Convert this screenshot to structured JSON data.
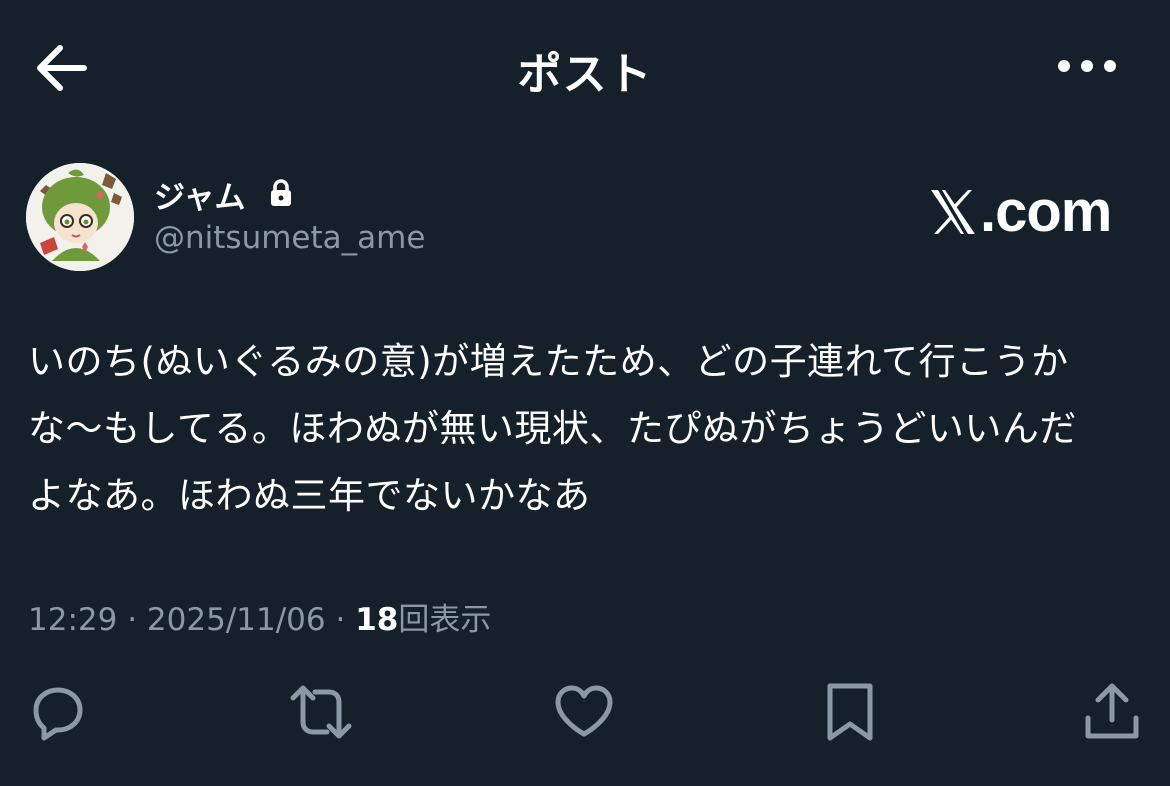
{
  "header": {
    "title": "ポスト",
    "back_icon": "arrow-left-icon",
    "more_icon": "more-horizontal-icon"
  },
  "author": {
    "display_name": "ジャム",
    "handle": "@nitsumeta_ame",
    "protected_icon": "lock-icon",
    "avatar": "avatar-illustration"
  },
  "brand": {
    "x_symbol": "𝕏",
    "domain": ".com"
  },
  "post": {
    "lines": [
      "いのち(ぬいぐるみの意)が増えたため、どの子連れて行こうか",
      "な〜もしてる。ほわぬが無い現状、たぴぬがちょうどいいんだ",
      "よなあ。ほわぬ三年でないかなあ"
    ]
  },
  "meta": {
    "time": "12:29",
    "separator": "·",
    "date": "2025/11/06",
    "views_count": "18",
    "views_label": "回表示"
  },
  "actions": {
    "reply_icon": "reply-icon",
    "repost_icon": "repost-icon",
    "like_icon": "heart-icon",
    "bookmark_icon": "bookmark-icon",
    "share_icon": "share-icon"
  },
  "colors": {
    "background": "#15202b",
    "text_primary": "#ffffff",
    "text_secondary": "#8b98a5"
  }
}
